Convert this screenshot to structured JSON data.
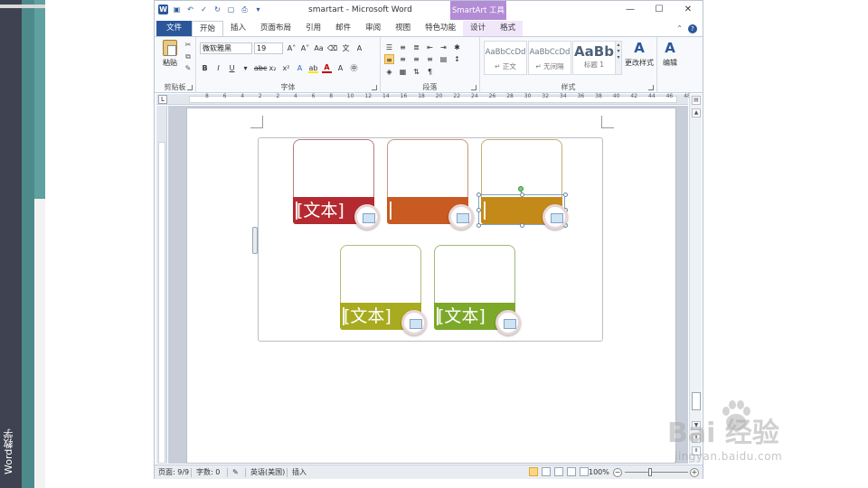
{
  "sidebar": {
    "label": "Word教学"
  },
  "window": {
    "title": "smartart - Microsoft Word",
    "context_tab": "SmartArt 工具",
    "controls": [
      "—",
      "☐",
      "✕"
    ]
  },
  "tabs": {
    "file": "文件",
    "items": [
      "开始",
      "插入",
      "页面布局",
      "引用",
      "邮件",
      "审阅",
      "视图",
      "特色功能",
      "设计",
      "格式"
    ],
    "active": "开始"
  },
  "ribbon": {
    "clipboard": {
      "label": "剪贴板",
      "paste": "粘贴"
    },
    "font": {
      "label": "字体",
      "font_name": "微软雅黑",
      "font_size": "19",
      "buttons": [
        "B",
        "I",
        "U",
        "abc",
        "x₂",
        "x²",
        "A",
        "A",
        "Aa",
        "A",
        "A",
        "A"
      ]
    },
    "paragraph": {
      "label": "段落"
    },
    "styles": {
      "label": "样式",
      "items": [
        {
          "sample": "AaBbCcDd",
          "name": "↵ 正文"
        },
        {
          "sample": "AaBbCcDd",
          "name": "↵ 无间隔"
        },
        {
          "sample": "AaBb",
          "name": "标题 1"
        }
      ],
      "change_styles": "更改样式"
    },
    "editing": {
      "label": "编辑"
    }
  },
  "ruler": {
    "numbers": [
      "8",
      "6",
      "4",
      "2",
      "2",
      "4",
      "6",
      "8",
      "10",
      "12",
      "14",
      "16",
      "18",
      "20",
      "22",
      "24",
      "26",
      "28",
      "30",
      "32",
      "34",
      "36",
      "38",
      "40",
      "42",
      "44",
      "46",
      "48"
    ]
  },
  "smartart": {
    "items": [
      {
        "text": "[文本]",
        "color": "#b42a30",
        "border": "#b97a7a"
      },
      {
        "text": "",
        "color": "#c85a22",
        "border": "#c7957a"
      },
      {
        "text": "",
        "color": "#c48a19",
        "border": "#c8ab75",
        "selected": true
      },
      {
        "text": "[文本]",
        "color": "#a8ab1f",
        "border": "#b8b97a"
      },
      {
        "text": "[文本]",
        "color": "#7ca92a",
        "border": "#9fb97a"
      }
    ]
  },
  "statusbar": {
    "page": "页面: 9/9",
    "words": "字数: 0",
    "language": "英语(美国)",
    "mode": "插入",
    "zoom": "100%"
  },
  "watermark": {
    "text": "Bai 经验",
    "url": "jingyan.baidu.com"
  }
}
